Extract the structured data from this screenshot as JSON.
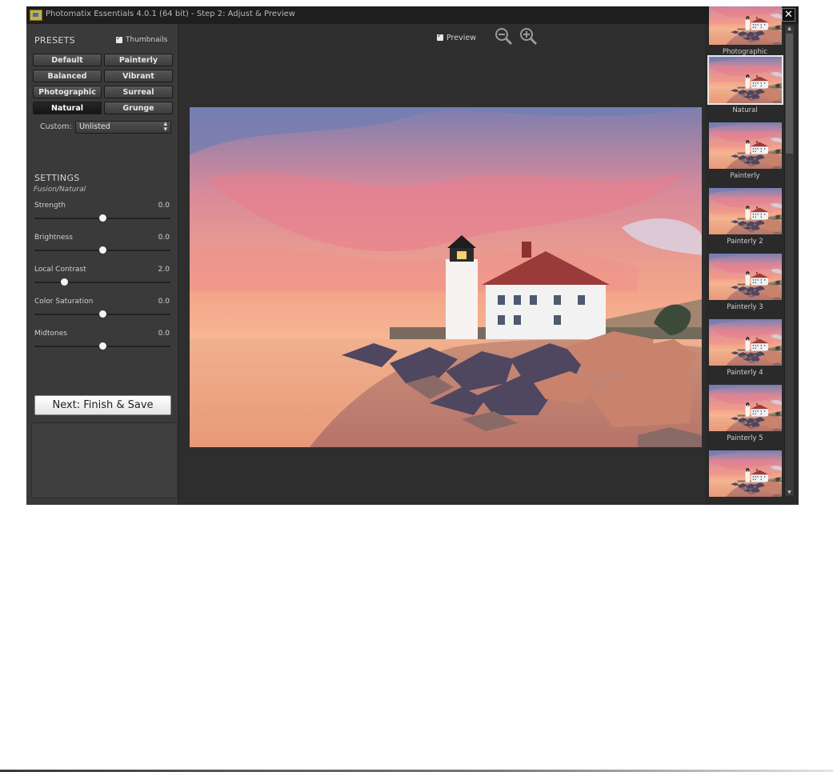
{
  "window": {
    "title": "Photomatix Essentials 4.0.1 (64 bit) - Step 2: Adjust & Preview",
    "minimize_glyph": "–",
    "close_glyph": "✕"
  },
  "presets": {
    "heading": "PRESETS",
    "thumbnails_checked": true,
    "thumbnails_label": "Thumbnails",
    "buttons": [
      {
        "label": "Default",
        "active": false
      },
      {
        "label": "Painterly",
        "active": false
      },
      {
        "label": "Balanced",
        "active": false
      },
      {
        "label": "Vibrant",
        "active": false
      },
      {
        "label": "Photographic",
        "active": false
      },
      {
        "label": "Surreal",
        "active": false
      },
      {
        "label": "Natural",
        "active": true
      },
      {
        "label": "Grunge",
        "active": false
      }
    ],
    "custom_label": "Custom:",
    "custom_value": "Unlisted"
  },
  "settings": {
    "heading": "SETTINGS",
    "subheading": "Fusion/Natural",
    "sliders": [
      {
        "label": "Strength",
        "value": "0.0",
        "level": 0.5
      },
      {
        "label": "Brightness",
        "value": "0.0",
        "level": 0.5
      },
      {
        "label": "Local Contrast",
        "value": "2.0",
        "level": 0.22
      },
      {
        "label": "Color Saturation",
        "value": "0.0",
        "level": 0.5
      },
      {
        "label": "Midtones",
        "value": "0.0",
        "level": 0.5
      }
    ]
  },
  "actions": {
    "next_label": "Next: Finish & Save"
  },
  "preview": {
    "checked": true,
    "label": "Preview",
    "zoom_out_icon": "zoom-out-icon",
    "zoom_in_icon": "zoom-in-icon"
  },
  "thumbnails": [
    {
      "label": "Photographic",
      "selected": false
    },
    {
      "label": "Natural",
      "selected": true
    },
    {
      "label": "Painterly",
      "selected": false
    },
    {
      "label": "Painterly 2",
      "selected": false
    },
    {
      "label": "Painterly 3",
      "selected": false
    },
    {
      "label": "Painterly 4",
      "selected": false
    },
    {
      "label": "Painterly 5",
      "selected": false
    },
    {
      "label": "",
      "selected": false
    }
  ],
  "colors": {
    "window_bg": "#3d3d3d",
    "titlebar": "#1e1e1e",
    "selected_outline": "#e8e8e8"
  }
}
